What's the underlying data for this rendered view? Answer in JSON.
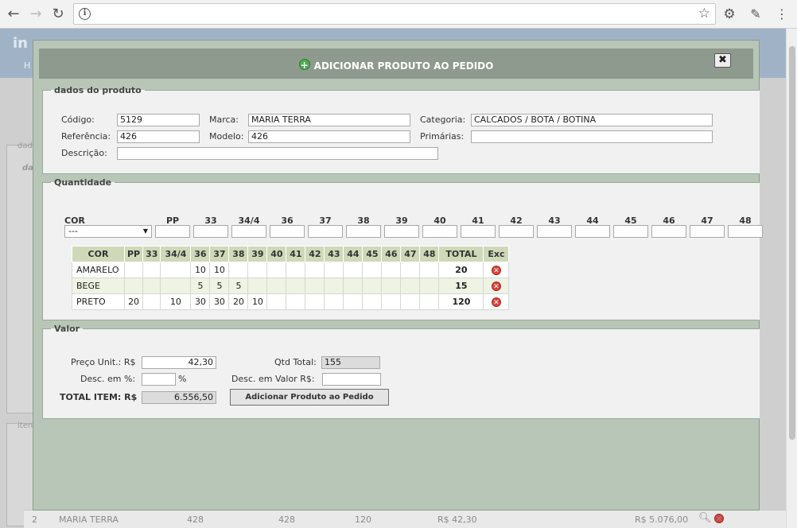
{
  "browser": {
    "info_icon": "info-icon",
    "url": ""
  },
  "background": {
    "logo": "in",
    "menu_label": "H",
    "panel_label": "dad",
    "panel_label2": "da",
    "panel_label3": "iten",
    "row": {
      "num": "2",
      "brand": "MARIA TERRA",
      "ref": "428",
      "model": "428",
      "qty": "120",
      "price": "R$ 42,30",
      "total": "R$ 5.076,00"
    }
  },
  "modal": {
    "title": "ADICIONAR PRODUTO AO PEDIDO",
    "close": "✖",
    "produto": {
      "legend": "dados do produto",
      "codigo_label": "Código:",
      "codigo": "5129",
      "marca_label": "Marca:",
      "marca": "MARIA TERRA",
      "categoria_label": "Categoria:",
      "categoria": "CALCADOS / BOTA / BOTINA",
      "referencia_label": "Referência:",
      "referencia": "426",
      "modelo_label": "Modelo:",
      "modelo": "426",
      "primarias_label": "Primárias:",
      "primarias": "",
      "descricao_label": "Descrição:",
      "descricao": ""
    },
    "quantidade": {
      "legend": "Quantidade",
      "cor_label": "COR",
      "cor_value": "---",
      "sizes": [
        "PP",
        "33",
        "34/4",
        "36",
        "37",
        "38",
        "39",
        "40",
        "41",
        "42",
        "43",
        "44",
        "45",
        "46",
        "47",
        "48"
      ],
      "table_headers": [
        "COR",
        "PP",
        "33",
        "34/4",
        "36",
        "37",
        "38",
        "39",
        "40",
        "41",
        "42",
        "43",
        "44",
        "45",
        "46",
        "47",
        "48",
        "TOTAL",
        "Exc"
      ],
      "rows": [
        {
          "cor": "AMARELO",
          "cells": [
            "",
            "",
            "",
            "10",
            "10",
            "",
            "",
            "",
            "",
            "",
            "",
            "",
            "",
            "",
            "",
            ""
          ],
          "total": "20"
        },
        {
          "cor": "BEGE",
          "cells": [
            "",
            "",
            "",
            "5",
            "5",
            "5",
            "",
            "",
            "",
            "",
            "",
            "",
            "",
            "",
            "",
            ""
          ],
          "total": "15"
        },
        {
          "cor": "PRETO",
          "cells": [
            "20",
            "",
            "10",
            "30",
            "30",
            "20",
            "10",
            "",
            "",
            "",
            "",
            "",
            "",
            "",
            "",
            ""
          ],
          "total": "120"
        }
      ]
    },
    "valor": {
      "legend": "Valor",
      "preco_label": "Preço Unit.: R$",
      "preco": "42,30",
      "qtd_total_label": "Qtd Total:",
      "qtd_total": "155",
      "desc_pct_label": "Desc. em %:",
      "desc_pct": "",
      "pct_sign": "%",
      "desc_valor_label": "Desc. em Valor R$:",
      "desc_valor": "",
      "total_label": "TOTAL ITEM: R$",
      "total": "6.556,50",
      "add_button": "Adicionar Produto ao Pedido"
    }
  }
}
